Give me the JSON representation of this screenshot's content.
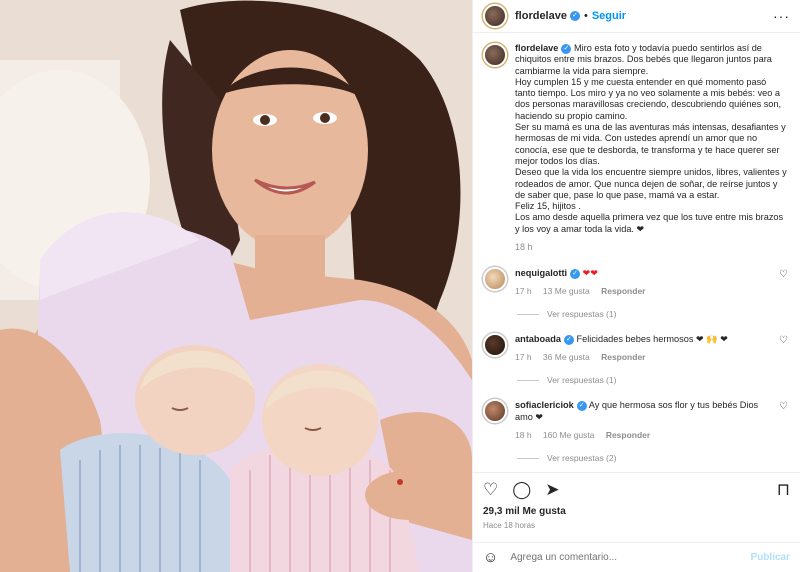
{
  "post": {
    "username": "flordelave",
    "follow_label": "Seguir",
    "caption_lines": [
      "Miro esta foto y todavía puedo sentirlos así de chiquitos entre mis brazos. Dos bebés que llegaron juntos para cambiarme la vida para siempre.",
      "Hoy cumplen 15 y me cuesta entender en qué momento pasó tanto tiempo. Los miro y ya no veo solamente a mis bebés: veo a dos personas maravillosas creciendo, descubriendo quiénes son, haciendo su propio camino.",
      "Ser su mamá es una de las aventuras más intensas, desafiantes y hermosas de mi vida. Con ustedes aprendí un amor que no conocía, ese que te desborda, te transforma y te hace querer ser mejor todos los días.",
      "Deseo que la vida los encuentre siempre unidos, libres, valientes y rodeados de amor. Que nunca dejen de soñar, de reírse juntos y de saber que, pase lo que pase, mamá va a estar.",
      "Feliz 15, hijitos .",
      "Los amo desde aquella primera vez que los tuve entre mis brazos y los voy a amar toda la vida. ❤"
    ],
    "caption_time": "18 h"
  },
  "comments": [
    {
      "username": "nequigalotti",
      "text": "❤❤",
      "time": "17 h",
      "likes": "13 Me gusta",
      "reply": "Responder",
      "replies": "Ver respuestas (1)"
    },
    {
      "username": "antaboada",
      "text": "Felicidades bebes hermosos ❤ 🙌 ❤",
      "time": "17 h",
      "likes": "36 Me gusta",
      "reply": "Responder",
      "replies": "Ver respuestas (1)"
    },
    {
      "username": "sofiaclericiok",
      "text": "Ay que hermosa sos flor y tus bebés Dios amo ❤",
      "time": "18 h",
      "likes": "160 Me gusta",
      "reply": "Responder",
      "replies": "Ver respuestas (2)"
    }
  ],
  "stats": {
    "likes": "29,3 mil Me gusta",
    "ago": "Hace 18 horas"
  },
  "composer": {
    "placeholder": "Agrega un comentario...",
    "publish": "Publicar"
  }
}
